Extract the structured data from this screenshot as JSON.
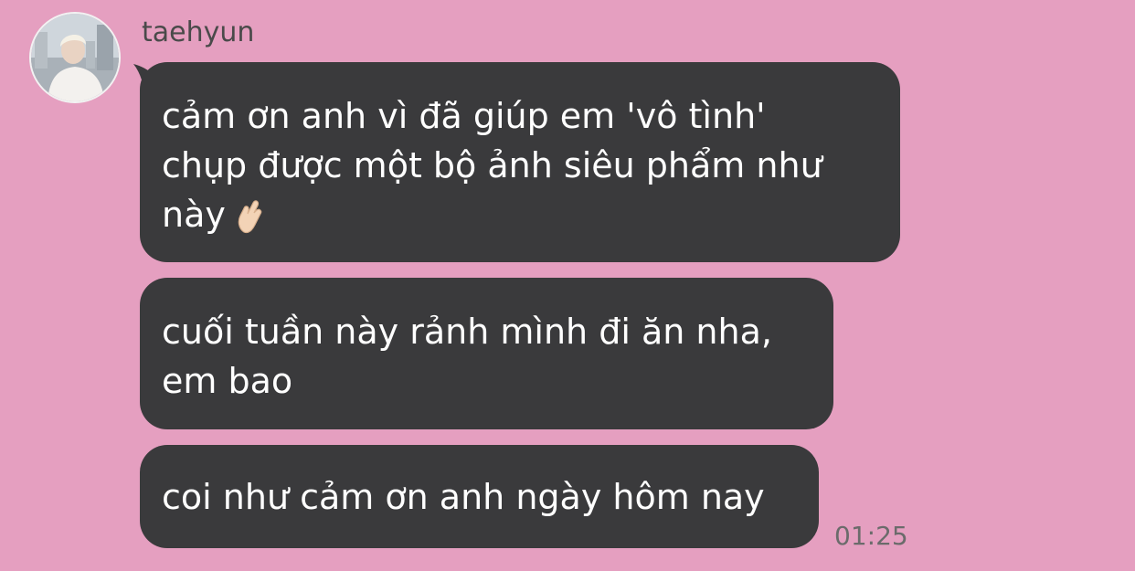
{
  "sender": {
    "name": "taehyun",
    "avatar_icon": "profile-photo"
  },
  "messages": [
    {
      "line1": "cảm ơn anh vì đã giúp em 'vô tình'",
      "line2": "chụp được một bộ ảnh siêu phẩm như",
      "line3": "này",
      "emoji": "crossed-fingers-icon"
    },
    {
      "line1": "cuối tuần này rảnh mình đi ăn nha,",
      "line2": "em bao"
    },
    {
      "line1": "coi như cảm ơn anh ngày hôm nay"
    }
  ],
  "timestamp": "01:25",
  "colors": {
    "background": "#e59fc0",
    "bubble": "#3a3a3c",
    "bubble_text": "#ffffff",
    "meta_text": "#6b6b6b"
  }
}
